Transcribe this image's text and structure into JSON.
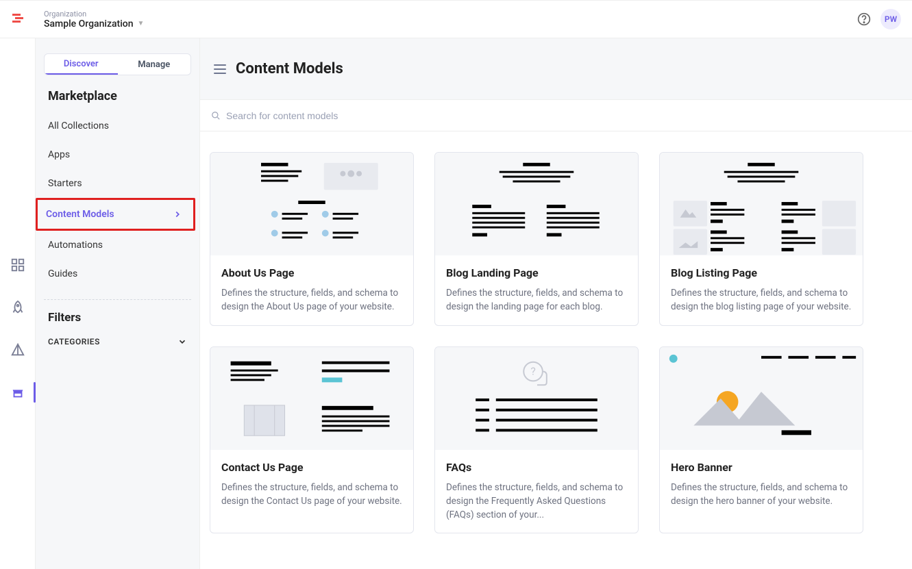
{
  "topbar": {
    "org_label": "Organization",
    "org_name": "Sample Organization",
    "avatar_initials": "PW"
  },
  "sidebar": {
    "tabs": {
      "discover": "Discover",
      "manage": "Manage"
    },
    "title": "Marketplace",
    "items": [
      {
        "label": "All Collections"
      },
      {
        "label": "Apps"
      },
      {
        "label": "Starters"
      },
      {
        "label": "Content Models"
      },
      {
        "label": "Automations"
      },
      {
        "label": "Guides"
      }
    ],
    "filters_title": "Filters",
    "categories_label": "CATEGORIES"
  },
  "main": {
    "title": "Content Models",
    "search_placeholder": "Search for content models"
  },
  "cards": [
    {
      "title": "About Us Page",
      "desc": "Defines the structure, fields, and schema to design the About Us page of your website."
    },
    {
      "title": "Blog Landing Page",
      "desc": "Defines the structure, fields, and schema to design the landing page for each blog."
    },
    {
      "title": "Blog Listing Page",
      "desc": "Defines the structure, fields, and schema to design the blog listing page of your website."
    },
    {
      "title": "Contact Us Page",
      "desc": "Defines the structure, fields, and schema to design the Contact Us page of your website."
    },
    {
      "title": "FAQs",
      "desc": "Defines the structure, fields, and schema to design the Frequently Asked Questions (FAQs) section of your..."
    },
    {
      "title": "Hero Banner",
      "desc": "Defines the structure, fields, and schema to design the hero banner of your website."
    }
  ]
}
